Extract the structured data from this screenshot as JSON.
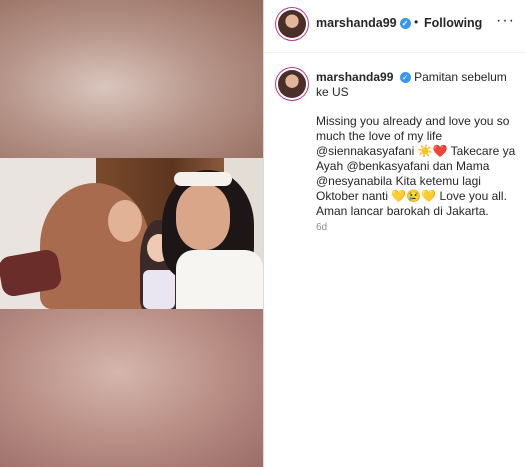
{
  "post": {
    "username": "marshanda99",
    "follow_status": "Following",
    "more_label": "···",
    "verified_icon": "✓"
  },
  "caption": {
    "username": "marshanda99",
    "first_line": "Pamitan sebelum ke US",
    "body_lines": [
      "Missing you already and love you so",
      "much the love of my life",
      "@siennakasyafani ☀️❤️ Takecare ya",
      "Ayah @benkasyafani dan Mama",
      "@nesyanabila Kita ketemu lagi",
      "Oktober nanti 💛😢💛 Love you all.",
      "Aman lancar barokah di Jakarta."
    ]
  },
  "timestamp": "6d"
}
